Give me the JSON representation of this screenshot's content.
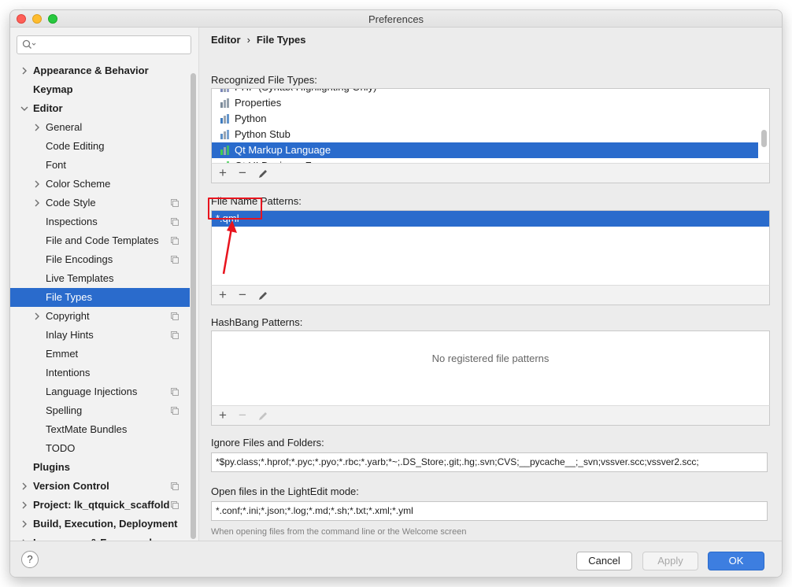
{
  "window": {
    "title": "Preferences"
  },
  "search": {
    "placeholder": ""
  },
  "sidebar": {
    "items": [
      {
        "label": "Appearance & Behavior",
        "level": 0,
        "bold": true,
        "chevron": "right"
      },
      {
        "label": "Keymap",
        "level": 0,
        "bold": true
      },
      {
        "label": "Editor",
        "level": 0,
        "bold": true,
        "chevron": "down"
      },
      {
        "label": "General",
        "level": 1,
        "chevron": "right"
      },
      {
        "label": "Code Editing",
        "level": 1
      },
      {
        "label": "Font",
        "level": 1
      },
      {
        "label": "Color Scheme",
        "level": 1,
        "chevron": "right"
      },
      {
        "label": "Code Style",
        "level": 1,
        "chevron": "right",
        "project": true
      },
      {
        "label": "Inspections",
        "level": 1,
        "project": true
      },
      {
        "label": "File and Code Templates",
        "level": 1,
        "project": true
      },
      {
        "label": "File Encodings",
        "level": 1,
        "project": true
      },
      {
        "label": "Live Templates",
        "level": 1
      },
      {
        "label": "File Types",
        "level": 1,
        "selected": true
      },
      {
        "label": "Copyright",
        "level": 1,
        "chevron": "right",
        "project": true
      },
      {
        "label": "Inlay Hints",
        "level": 1,
        "project": true
      },
      {
        "label": "Emmet",
        "level": 1
      },
      {
        "label": "Intentions",
        "level": 1
      },
      {
        "label": "Language Injections",
        "level": 1,
        "project": true
      },
      {
        "label": "Spelling",
        "level": 1,
        "project": true
      },
      {
        "label": "TextMate Bundles",
        "level": 1
      },
      {
        "label": "TODO",
        "level": 1
      },
      {
        "label": "Plugins",
        "level": 0,
        "bold": true
      },
      {
        "label": "Version Control",
        "level": 0,
        "bold": true,
        "chevron": "right",
        "project": true
      },
      {
        "label": "Project: lk_qtquick_scaffold",
        "level": 0,
        "bold": true,
        "chevron": "right",
        "project": true
      },
      {
        "label": "Build, Execution, Deployment",
        "level": 0,
        "bold": true,
        "chevron": "right"
      },
      {
        "label": "Languages & Frameworks",
        "level": 0,
        "bold": true,
        "chevron": "right"
      }
    ]
  },
  "breadcrumb": {
    "parent": "Editor",
    "separator": "›",
    "current": "File Types"
  },
  "recognized": {
    "label": "Recognized File Types:",
    "items": [
      {
        "label": "PHP (Syntax Highlighting Only)",
        "icon": "php-file-icon"
      },
      {
        "label": "Properties",
        "icon": "properties-file-icon"
      },
      {
        "label": "Python",
        "icon": "python-file-icon"
      },
      {
        "label": "Python Stub",
        "icon": "python-stub-file-icon"
      },
      {
        "label": "Qt Markup Language",
        "icon": "qml-file-icon",
        "selected": true
      },
      {
        "label": "Qt UI Designer Form",
        "icon": "qt-ui-file-icon"
      }
    ]
  },
  "patterns": {
    "label": "File Name Patterns:",
    "items": [
      "*.qml"
    ]
  },
  "hashbang": {
    "label": "HashBang Patterns:",
    "empty_text": "No registered file patterns"
  },
  "ignore": {
    "label": "Ignore Files and Folders:",
    "value": "*$py.class;*.hprof;*.pyc;*.pyo;*.rbc;*.yarb;*~;.DS_Store;.git;.hg;.svn;CVS;__pycache__;_svn;vssver.scc;vssver2.scc;"
  },
  "lightedit": {
    "label": "Open files in the LightEdit mode:",
    "value": "*.conf;*.ini;*.json;*.log;*.md;*.sh;*.txt;*.xml;*.yml",
    "hint": "When opening files from the command line or the Welcome screen"
  },
  "toolbar": {
    "add": "+",
    "remove": "−"
  },
  "footer": {
    "help": "?",
    "cancel": "Cancel",
    "apply": "Apply",
    "ok": "OK"
  },
  "colors": {
    "selection": "#2a6bcc",
    "highlight": "#e8141e",
    "ok_button": "#3d7ee0"
  }
}
